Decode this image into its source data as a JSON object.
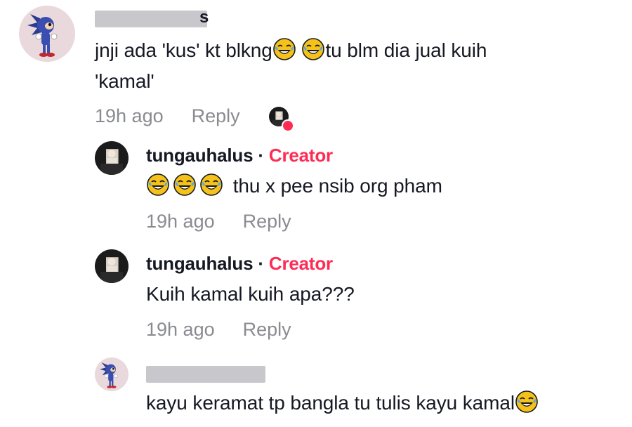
{
  "comments": [
    {
      "username_tail": "s",
      "text_a": "jnji ada 'kus' kt blkng",
      "text_b": "tu blm dia jual kuih",
      "text_line2": "'kamal'",
      "time": "19h ago",
      "reply_label": "Reply"
    },
    {
      "username": "tungauhalus",
      "separator": "·",
      "creator_badge": "Creator",
      "text": "thu x pee nsib org pham",
      "time": "19h ago",
      "reply_label": "Reply"
    },
    {
      "username": "tungauhalus",
      "separator": "·",
      "creator_badge": "Creator",
      "text": "Kuih kamal kuih apa???",
      "time": "19h ago",
      "reply_label": "Reply"
    },
    {
      "text": "kayu keramat tp bangla tu tulis kayu kamal"
    }
  ],
  "icons": {
    "emoji": "face-with-tears-of-joy-icon",
    "liked_by_creator": "creator-liked-icon"
  },
  "colors": {
    "creator": "#fe2c55",
    "meta": "#8a8b91",
    "text": "#161823"
  }
}
